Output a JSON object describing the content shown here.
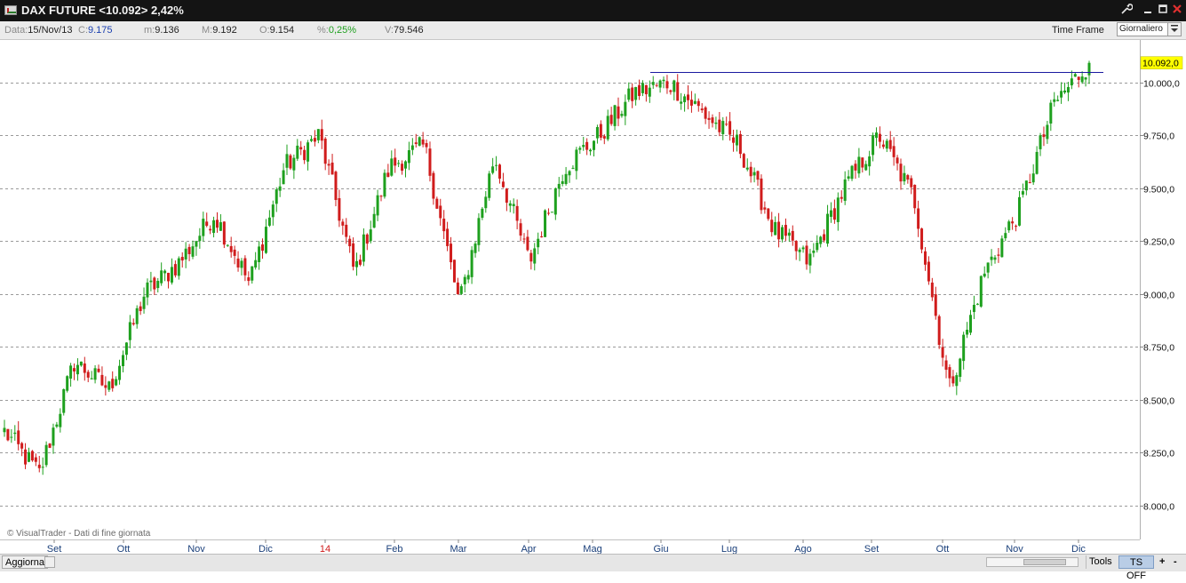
{
  "window": {
    "title": "DAX FUTURE <10.092> 2,42%",
    "icons": [
      "app-chart-icon",
      "wrench-icon",
      "minimize-icon",
      "maximize-icon",
      "close-icon"
    ],
    "close_color": "#e03030"
  },
  "infobar": {
    "data_label": "Data:",
    "data_value": "15/Nov/13",
    "close_label": "C:",
    "close_value": "9.175",
    "min_label": "m:",
    "min_value": "9.136",
    "max_label": "M:",
    "max_value": "9.192",
    "open_label": "O:",
    "open_value": "9.154",
    "pct_label": "%:",
    "pct_value": "0,25%",
    "vol_label": "V:",
    "vol_value": "79.546",
    "timeframe_label": "Time Frame",
    "timeframe_value": "Giornaliero"
  },
  "bottombar": {
    "refresh_label": "Aggiorna",
    "tools_label": "Tools",
    "ts_label": "TS OFF",
    "plus_label": "+",
    "minus_label": "-"
  },
  "chart_data": {
    "type": "candlestick",
    "watermark": "© VisualTrader - Dati di fine giornata",
    "x_labels": [
      {
        "label": "Set",
        "highlight": false
      },
      {
        "label": "Ott",
        "highlight": false
      },
      {
        "label": "Nov",
        "highlight": false
      },
      {
        "label": "Dic",
        "highlight": false
      },
      {
        "label": "14",
        "highlight": true
      },
      {
        "label": "Feb",
        "highlight": false
      },
      {
        "label": "Mar",
        "highlight": false
      },
      {
        "label": "Apr",
        "highlight": false
      },
      {
        "label": "Mag",
        "highlight": false
      },
      {
        "label": "Giu",
        "highlight": false
      },
      {
        "label": "Lug",
        "highlight": false
      },
      {
        "label": "Ago",
        "highlight": false
      },
      {
        "label": "Set",
        "highlight": false
      },
      {
        "label": "Ott",
        "highlight": false
      },
      {
        "label": "Nov",
        "highlight": false
      },
      {
        "label": "Dic",
        "highlight": false
      }
    ],
    "y_ticks": [
      10000,
      9750,
      9500,
      9250,
      9000,
      8750,
      8500,
      8250,
      8000
    ],
    "y_tick_labels": [
      "10.000,0",
      "9.750,0",
      "9.500,0",
      "9.250,0",
      "9.000,0",
      "8.750,0",
      "8.500,0",
      "8.250,0",
      "8.000,0"
    ],
    "ylim": [
      7840,
      10200
    ],
    "last_price": 10092,
    "last_price_label": "10.092,0",
    "resistance_level": 10050,
    "grid": "horizontal-dashed",
    "colors": {
      "up": "#1ea01e",
      "down": "#d01c1c",
      "resistance": "#1a1aa0",
      "last_price_bg": "#ffff00"
    },
    "approx_path": [
      {
        "month": "Set 2013",
        "value": 8350
      },
      {
        "month": "Set 2013",
        "value": 8150
      },
      {
        "month": "Ott 2013",
        "value": 8680
      },
      {
        "month": "Ott 2013",
        "value": 8550
      },
      {
        "month": "Nov 2013",
        "value": 9000
      },
      {
        "month": "Nov 2013",
        "value": 9150
      },
      {
        "month": "Dic 2013",
        "value": 9380
      },
      {
        "month": "Dic 2013",
        "value": 9050
      },
      {
        "month": "Gen 2014",
        "value": 9600
      },
      {
        "month": "Gen 2014",
        "value": 9750
      },
      {
        "month": "Feb 2014",
        "value": 9100
      },
      {
        "month": "Feb 2014",
        "value": 9600
      },
      {
        "month": "Mar 2014",
        "value": 9700
      },
      {
        "month": "Mar 2014",
        "value": 8950
      },
      {
        "month": "Apr 2014",
        "value": 9650
      },
      {
        "month": "Apr 2014",
        "value": 9150
      },
      {
        "month": "Mag 2014",
        "value": 9600
      },
      {
        "month": "Mag 2014",
        "value": 9750
      },
      {
        "month": "Giu 2014",
        "value": 9950
      },
      {
        "month": "Giu 2014",
        "value": 10000
      },
      {
        "month": "Lug 2014",
        "value": 9850
      },
      {
        "month": "Lug 2014",
        "value": 9700
      },
      {
        "month": "Ago 2014",
        "value": 9300
      },
      {
        "month": "Ago 2014",
        "value": 9150
      },
      {
        "month": "Set 2014",
        "value": 9500
      },
      {
        "month": "Set 2014",
        "value": 9750
      },
      {
        "month": "Ott 2014",
        "value": 9450
      },
      {
        "month": "Ott 2014",
        "value": 8550
      },
      {
        "month": "Nov 2014",
        "value": 9100
      },
      {
        "month": "Nov 2014",
        "value": 9400
      },
      {
        "month": "Dic 2014",
        "value": 9900
      },
      {
        "month": "Dic 2014",
        "value": 10092
      }
    ]
  }
}
